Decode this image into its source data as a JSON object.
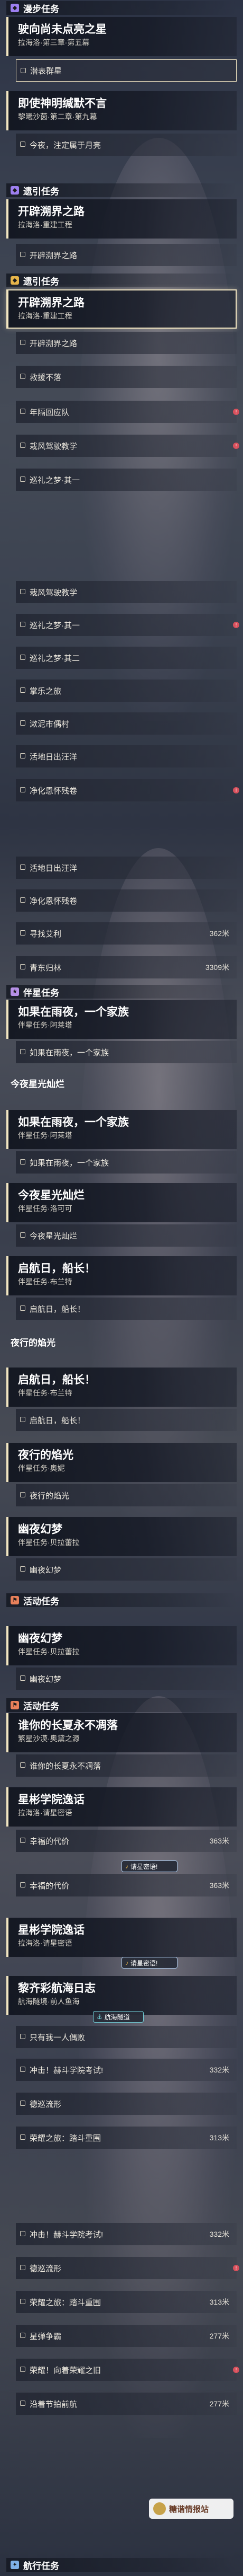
{
  "headers": [
    {
      "label": "漫步任务",
      "color": "purple",
      "icon": "bookmark-icon"
    },
    {
      "label": "遗引任务",
      "color": "purple",
      "icon": "bookmark-icon"
    },
    {
      "label": "遗引任务",
      "color": "gold",
      "icon": "bookmark-icon"
    },
    {
      "label": "伴星任务",
      "color": "violet",
      "icon": "star-icon"
    },
    {
      "label": "活动任务",
      "color": "orange",
      "icon": "flag-icon"
    },
    {
      "label": "活动任务",
      "color": "orange",
      "icon": "flag-icon"
    },
    {
      "label": "航行任务",
      "color": "blue",
      "icon": "compass-icon"
    }
  ],
  "cards": [
    {
      "title": "驶向尚未点亮之星",
      "sub": "拉海洛·第三章·第五幕"
    },
    {
      "title": "即使神明缄默不言",
      "sub": "黎曦沙茵·第二章·第九幕"
    },
    {
      "title": "开辟溯界之路",
      "sub": "拉海洛·重建工程"
    },
    {
      "title": "开辟溯界之路",
      "sub": "拉海洛·重建工程"
    },
    {
      "title": "如果在雨夜，一个家族",
      "sub": "伴星任务·阿莱塔"
    },
    {
      "title": "如果在雨夜，一个家族",
      "sub": "伴星任务·阿莱塔"
    },
    {
      "title": "今夜星光灿烂",
      "sub": "伴星任务·洛可可"
    },
    {
      "title": "启航日，船长！",
      "sub": "伴星任务·布兰特"
    },
    {
      "title": "启航日，船长！",
      "sub": "伴星任务·布兰特"
    },
    {
      "title": "夜行的焰光",
      "sub": "伴星任务·奥妮"
    },
    {
      "title": "幽夜幻梦",
      "sub": "伴星任务·贝拉蕾拉"
    },
    {
      "title": "幽夜幻梦",
      "sub": "伴星任务·贝拉蕾拉"
    },
    {
      "title": "谁你的长夏永不凋落",
      "sub": "繁星沙漠·奥黛之源"
    },
    {
      "title": "星彬学院逸话",
      "sub": "拉海洛·请星密语"
    },
    {
      "title": "星彬学院逸话",
      "sub": "拉海洛·请星密语"
    },
    {
      "title": "黎齐彩航海日志",
      "sub": "航海隧境·前人鱼海"
    }
  ],
  "plain_titles": [
    {
      "title": "今夜星光灿烂"
    },
    {
      "title": "夜行的焰光"
    }
  ],
  "rows": [
    {
      "text": "潜表群星"
    },
    {
      "text": "今夜，注定属于月亮"
    },
    {
      "text": "开辟溯界之路"
    },
    {
      "text": "开辟溯界之路"
    },
    {
      "text": "救援不落"
    },
    {
      "text": "年隔回应队"
    },
    {
      "text": "栽风驾驶教学"
    },
    {
      "text": "巡礼之梦·其一"
    },
    {
      "text": "栽风驾驶教学"
    },
    {
      "text": "巡礼之梦·其一"
    },
    {
      "text": "巡礼之梦·其二"
    },
    {
      "text": "掌乐之旅"
    },
    {
      "text": "漱泥市偶村"
    },
    {
      "text": "活地日出汪洋"
    },
    {
      "text": "净化恩怀残卷"
    },
    {
      "text": "活地日出汪洋"
    },
    {
      "text": "净化恩怀残卷"
    },
    {
      "text": "寻找艾利",
      "dist": "362米"
    },
    {
      "text": "青东归林",
      "dist": "3309米"
    },
    {
      "text": "如果在雨夜，一个家族"
    },
    {
      "text": "如果在雨夜，一个家族"
    },
    {
      "text": "今夜星光灿烂"
    },
    {
      "text": "启航日，船长！"
    },
    {
      "text": "启航日，船长！"
    },
    {
      "text": "夜行的焰光"
    },
    {
      "text": "幽夜幻梦"
    },
    {
      "text": "幽夜幻梦"
    },
    {
      "text": "谁你的长夏永不凋落"
    },
    {
      "text": "幸福的代价",
      "dist": "363米"
    },
    {
      "text": "幸福的代价",
      "dist": "363米"
    },
    {
      "text": "只有我一人偶败"
    },
    {
      "text": "冲击！赫斗学院考试!",
      "dist": "332米"
    },
    {
      "text": "德巡流形"
    },
    {
      "text": "荣耀之旅：踏斗重围",
      "dist": "313米"
    },
    {
      "text": "冲击！赫斗学院考试!",
      "dist": "332米"
    },
    {
      "text": "德巡流形"
    },
    {
      "text": "荣耀之旅：踏斗重围",
      "dist": "313米"
    },
    {
      "text": "星弹争霸",
      "dist": "277米"
    },
    {
      "text": "荣耀！向着荣耀之旧"
    },
    {
      "text": "沿着节拍前航",
      "dist": "277米"
    }
  ],
  "tracked": [
    {
      "label": "请星密语!"
    },
    {
      "label": "请星密语!"
    },
    {
      "label": "航海隧道"
    }
  ],
  "stamp": {
    "text": "糖谐情报站"
  },
  "colors": {
    "accent": "#f2e6c2",
    "badge_red": "#d8505c",
    "gold": "#e7b54a"
  }
}
